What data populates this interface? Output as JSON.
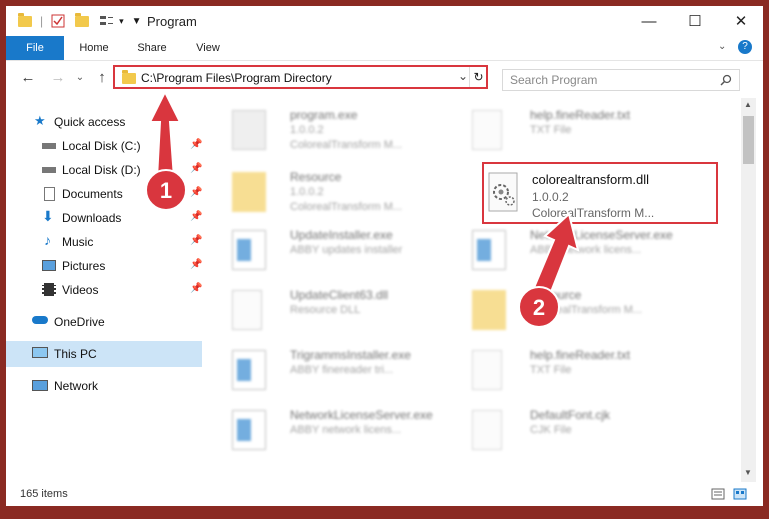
{
  "window": {
    "title": "Program",
    "controls": {
      "minimize": "—",
      "maximize": "☐",
      "close": "✕"
    }
  },
  "ribbon": {
    "tabs": [
      "File",
      "Home",
      "Share",
      "View"
    ],
    "help": "?"
  },
  "address": {
    "path": "C:\\Program Files\\Program Directory",
    "refresh_icon": "refresh-icon"
  },
  "search": {
    "placeholder": "Search Program"
  },
  "sidebar": {
    "items": [
      {
        "label": "Quick access",
        "icon": "star-icon"
      },
      {
        "label": "Local Disk (C:)",
        "icon": "drive-icon"
      },
      {
        "label": "Local Disk (D:)",
        "icon": "drive-icon"
      },
      {
        "label": "Documents",
        "icon": "documents-icon"
      },
      {
        "label": "Downloads",
        "icon": "downloads-icon"
      },
      {
        "label": "Music",
        "icon": "music-icon"
      },
      {
        "label": "Pictures",
        "icon": "pictures-icon"
      },
      {
        "label": "Videos",
        "icon": "videos-icon"
      },
      {
        "label": "OneDrive",
        "icon": "cloud-icon"
      },
      {
        "label": "This PC",
        "icon": "pc-icon"
      },
      {
        "label": "Network",
        "icon": "network-icon"
      }
    ]
  },
  "files": [
    {
      "name": "program.exe",
      "version": "1.0.0.2",
      "desc": "ColorealTransform M..."
    },
    {
      "name": "help.fineReader.txt",
      "version": "TXT File",
      "desc": ""
    },
    {
      "name": "Resource",
      "version": "1.0.0.2",
      "desc": "ColorealTransform M..."
    },
    {
      "name": "colorealtransform.dll",
      "version": "1.0.0.2",
      "desc": "ColorealTransform M..."
    },
    {
      "name": "UpdateInstaller.exe",
      "version": "ABBY updates installer",
      "desc": ""
    },
    {
      "name": "NetworkLicenseServer.exe",
      "version": "ABBY network licens...",
      "desc": ""
    },
    {
      "name": "UpdateClient63.dll",
      "version": "Resource DLL",
      "desc": ""
    },
    {
      "name": "Resource",
      "version": "ColorealTransform M...",
      "desc": ""
    },
    {
      "name": "TrigrammsInstaller.exe",
      "version": "ABBY finereader tri...",
      "desc": ""
    },
    {
      "name": "help.fineReader.txt",
      "version": "TXT File",
      "desc": ""
    },
    {
      "name": "NetworkLicenseServer.exe",
      "version": "ABBY network licens...",
      "desc": ""
    },
    {
      "name": "DefaultFont.cjk",
      "version": "CJK File",
      "desc": ""
    }
  ],
  "annotations": {
    "one": "1",
    "two": "2"
  },
  "status": {
    "count": "165 items"
  },
  "colors": {
    "accent": "#1979ca",
    "highlight": "#d9363e",
    "background": "#8a2a22"
  }
}
